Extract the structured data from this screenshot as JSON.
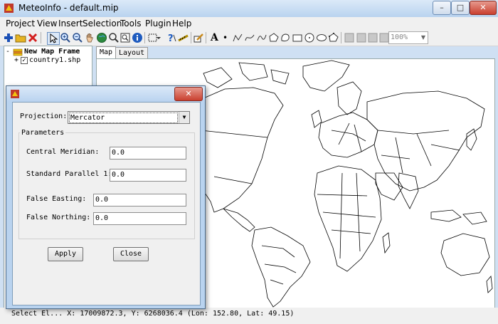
{
  "app": {
    "title": "MeteoInfo - default.mip"
  },
  "window_buttons": {
    "minimize": "–",
    "maximize": "□",
    "close": "✕"
  },
  "menu": [
    "Project",
    "View",
    "Insert",
    "Selection",
    "Tools",
    "Plugin",
    "Help"
  ],
  "toolbar": {
    "zoom_value": "100%",
    "text_tool": "A",
    "point_tool": "•"
  },
  "layers": {
    "frame": {
      "expand": "-",
      "label": "New Map Frame"
    },
    "layer": {
      "expand": "+",
      "label": "country1.shp",
      "checked": true
    }
  },
  "tabs": [
    "Map",
    "Layout"
  ],
  "dialog": {
    "projection_label": "Projection:",
    "projection_value": "Mercator",
    "parameters_title": "Parameters",
    "central_meridian_label": "Central Meridian:",
    "central_meridian_value": "0.0",
    "standard_parallel_label": "Standard Parallel 1:",
    "standard_parallel_value": "0.0",
    "false_easting_label": "False Easting:",
    "false_easting_value": "0.0",
    "false_northing_label": "False Northing:",
    "false_northing_value": "0.0",
    "apply_label": "Apply",
    "close_label": "Close",
    "close_x": "✕"
  },
  "status": {
    "text": "Select El...   X: 17009872.3, Y: 6268036.4 (Lon: 152.80, Lat: 49.15)"
  }
}
